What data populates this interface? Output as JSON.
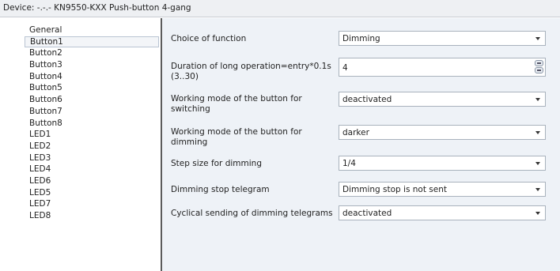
{
  "window": {
    "title": "Device: -.-.- KN9550-KXX Push-button 4-gang"
  },
  "sidebar": {
    "items": [
      {
        "label": "General",
        "selected": false
      },
      {
        "label": "Button1",
        "selected": true
      },
      {
        "label": "Button2",
        "selected": false
      },
      {
        "label": "Button3",
        "selected": false
      },
      {
        "label": "Button4",
        "selected": false
      },
      {
        "label": "Button5",
        "selected": false
      },
      {
        "label": "Button6",
        "selected": false
      },
      {
        "label": "Button7",
        "selected": false
      },
      {
        "label": "Button8",
        "selected": false
      },
      {
        "label": "LED1",
        "selected": false
      },
      {
        "label": "LED2",
        "selected": false
      },
      {
        "label": "LED3",
        "selected": false
      },
      {
        "label": "LED4",
        "selected": false
      },
      {
        "label": "LED6",
        "selected": false
      },
      {
        "label": "LED5",
        "selected": false
      },
      {
        "label": "LED7",
        "selected": false
      },
      {
        "label": "LED8",
        "selected": false
      }
    ]
  },
  "params": [
    {
      "label": "Choice of function",
      "value": "Dimming",
      "control": "dropdown"
    },
    {
      "label": "Duration of long operation=entry*0.1s (3..30)",
      "value": "4",
      "control": "spinner"
    },
    {
      "label": "Working mode of the button for switching",
      "value": "deactivated",
      "control": "dropdown"
    },
    {
      "label": "Working mode of the button for dimming",
      "value": "darker",
      "control": "dropdown"
    },
    {
      "label": "Step size for dimming",
      "value": "1/4",
      "control": "dropdown"
    },
    {
      "label": "Dimming stop telegram",
      "value": "Dimming stop is not sent",
      "control": "dropdown"
    },
    {
      "label": "Cyclical sending of dimming telegrams",
      "value": "deactivated",
      "control": "dropdown"
    }
  ]
}
